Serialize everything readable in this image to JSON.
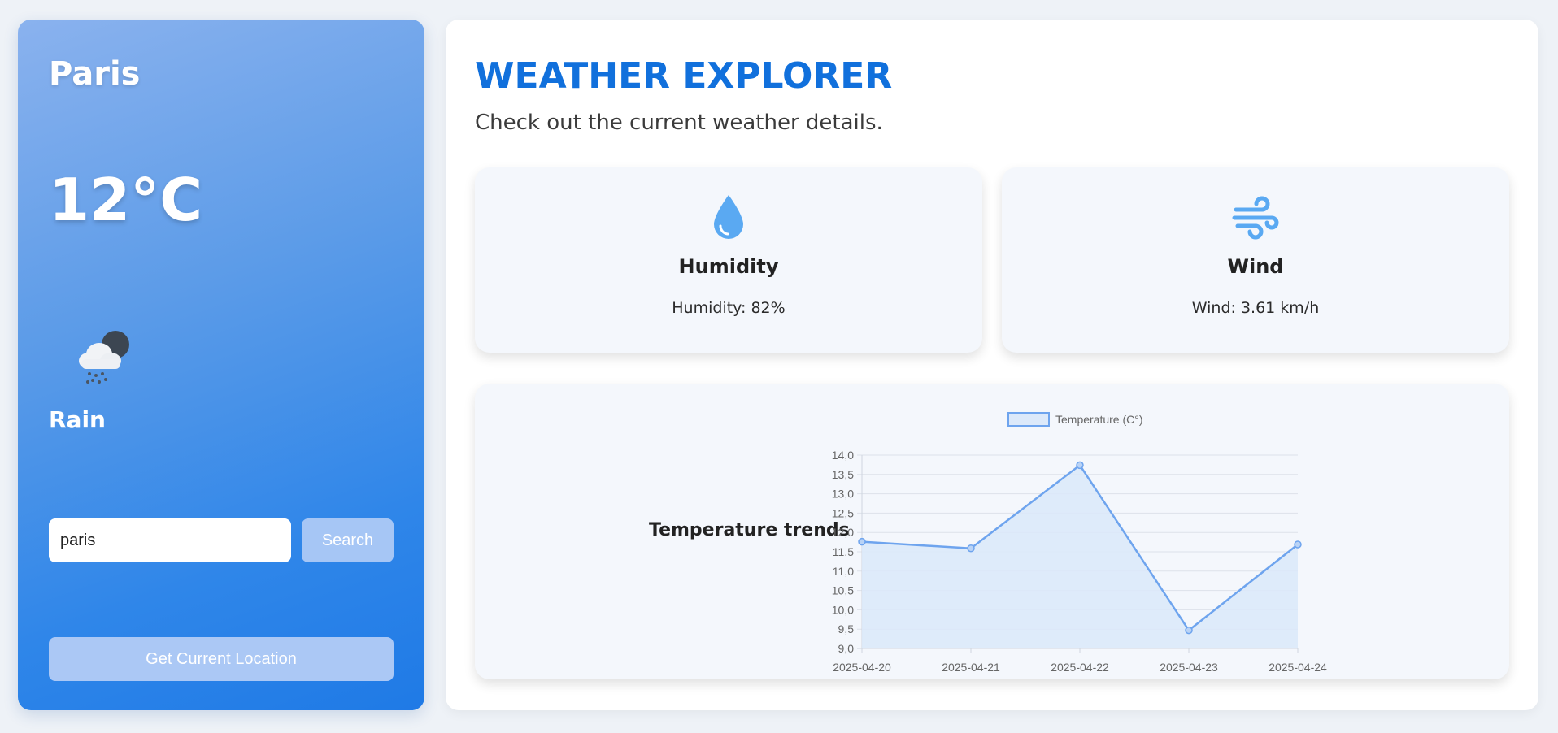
{
  "sidebar": {
    "city": "Paris",
    "temperature": "12°C",
    "condition_icon": "cloud-rain-moon-icon",
    "condition": "Rain",
    "search": {
      "value": "paris",
      "button_label": "Search"
    },
    "location_button_label": "Get Current Location"
  },
  "header": {
    "title": "WEATHER EXPLORER",
    "subtitle": "Check out the current weather details."
  },
  "cards": {
    "humidity": {
      "icon": "water-drop-icon",
      "title": "Humidity",
      "text": "Humidity: 82%"
    },
    "wind": {
      "icon": "wind-icon",
      "title": "Wind",
      "text": "Wind: 3.61 km/h"
    }
  },
  "chart_section": {
    "title": "Temperature trends"
  },
  "colors": {
    "accent": "#1170dc",
    "icon_blue": "#5aa9f2",
    "line": "#6ea4ee",
    "fill": "#dce9fa"
  },
  "chart_data": {
    "type": "area",
    "x": [
      "2025-04-20",
      "2025-04-21",
      "2025-04-22",
      "2025-04-23",
      "2025-04-24"
    ],
    "series": [
      {
        "name": "Temperature (C°)",
        "values": [
          11.76,
          11.59,
          13.74,
          9.47,
          11.69
        ]
      }
    ],
    "ylim": [
      9.0,
      14.0
    ],
    "yticks": [
      "14,0",
      "13,5",
      "13,0",
      "12,5",
      "12,0",
      "11,5",
      "11,0",
      "10,5",
      "10,0",
      "9,5",
      "9,0"
    ],
    "grid": true,
    "legend": "top"
  }
}
